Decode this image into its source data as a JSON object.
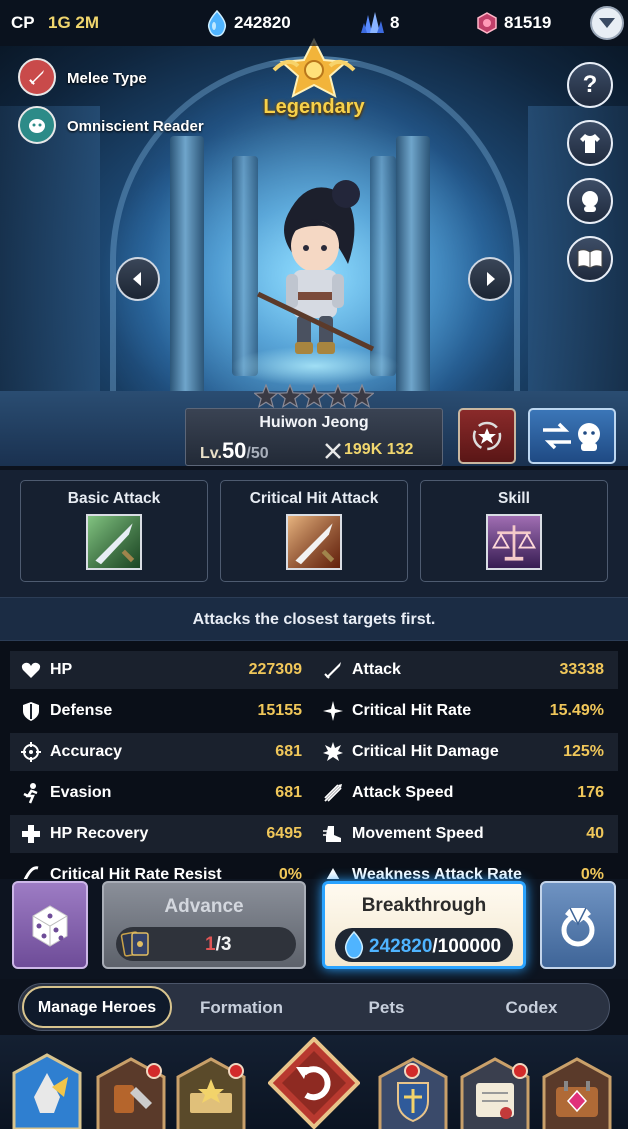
{
  "topbar": {
    "cp_label": "CP",
    "cp_value": "1G 2M",
    "gems": "242820",
    "crystals": "8",
    "tokens": "81519"
  },
  "hero": {
    "type_label": "Melee Type",
    "affiliation": "Omniscient Reader",
    "rarity": "Legendary",
    "stars": 5,
    "name": "Huiwon Jeong",
    "level_prefix": "Lv.",
    "level": "50",
    "level_max": "/50",
    "power": "199K 132"
  },
  "abilities": [
    {
      "label": "Basic Attack"
    },
    {
      "label": "Critical Hit Attack"
    },
    {
      "label": "Skill"
    }
  ],
  "description": "Attacks the closest targets first.",
  "stats": {
    "left": [
      {
        "label": "HP",
        "value": "227309",
        "icon": "heart-icon"
      },
      {
        "label": "Defense",
        "value": "15155",
        "icon": "shield-icon"
      },
      {
        "label": "Accuracy",
        "value": "681",
        "icon": "crosshair-icon"
      },
      {
        "label": "Evasion",
        "value": "681",
        "icon": "dodge-icon"
      },
      {
        "label": "HP Recovery",
        "value": "6495",
        "icon": "plus-icon"
      },
      {
        "label": "Critical Hit Rate Resist",
        "value": "0%",
        "icon": "resist-icon"
      }
    ],
    "right": [
      {
        "label": "Attack",
        "value": "33338",
        "icon": "sword-icon"
      },
      {
        "label": "Critical Hit Rate",
        "value": "15.49%",
        "icon": "sparkle-icon"
      },
      {
        "label": "Critical Hit Damage",
        "value": "125%",
        "icon": "burst-icon"
      },
      {
        "label": "Attack Speed",
        "value": "176",
        "icon": "speed-icon"
      },
      {
        "label": "Movement Speed",
        "value": "40",
        "icon": "boot-icon"
      },
      {
        "label": "Weakness Attack Rate",
        "value": "0%",
        "icon": "weakness-icon"
      }
    ]
  },
  "actions": {
    "advance_label": "Advance",
    "advance_current": "1",
    "advance_total": "/3",
    "breakthrough_label": "Breakthrough",
    "breakthrough_have": "242820",
    "breakthrough_need": "/100000"
  },
  "tabs": [
    {
      "label": "Manage Heroes",
      "active": true
    },
    {
      "label": "Formation",
      "active": false
    },
    {
      "label": "Pets",
      "active": false
    },
    {
      "label": "Codex",
      "active": false
    }
  ],
  "colors": {
    "accent_gold": "#f0c75a",
    "breakthrough_glow": "#2aa3ff",
    "dice_purple": "#8c6bb1",
    "level_red": "#e05555"
  }
}
